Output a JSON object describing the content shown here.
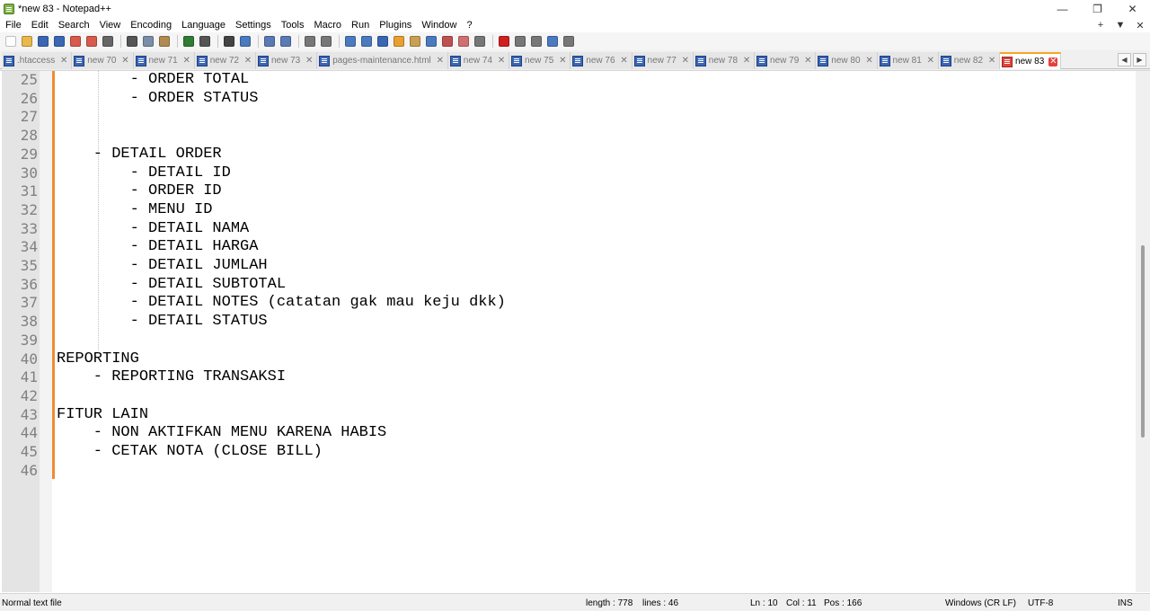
{
  "window": {
    "title": "*new 83 - Notepad++",
    "controls": [
      "—",
      "❐",
      "✕"
    ]
  },
  "menu": {
    "items": [
      "File",
      "Edit",
      "Search",
      "View",
      "Encoding",
      "Language",
      "Settings",
      "Tools",
      "Macro",
      "Run",
      "Plugins",
      "Window",
      "?"
    ],
    "right_controls": [
      "+",
      "▼",
      "✕"
    ]
  },
  "toolbar": {
    "buttons": [
      {
        "name": "new-file-icon",
        "color": "#ffffff"
      },
      {
        "name": "open-file-icon",
        "color": "#e8b84a"
      },
      {
        "name": "save-icon",
        "color": "#3a66b5"
      },
      {
        "name": "save-all-icon",
        "color": "#3a66b5"
      },
      {
        "name": "close-icon",
        "color": "#d95a4a"
      },
      {
        "name": "close-all-icon",
        "color": "#d95a4a"
      },
      {
        "name": "print-icon",
        "color": "#666666"
      },
      {
        "name": "sep"
      },
      {
        "name": "cut-icon",
        "color": "#555555"
      },
      {
        "name": "copy-icon",
        "color": "#7a8ea8"
      },
      {
        "name": "paste-icon",
        "color": "#b08a50"
      },
      {
        "name": "sep"
      },
      {
        "name": "undo-icon",
        "color": "#2e7d32"
      },
      {
        "name": "redo-icon",
        "color": "#555555"
      },
      {
        "name": "sep"
      },
      {
        "name": "find-icon",
        "color": "#444444"
      },
      {
        "name": "replace-icon",
        "color": "#4a7abf"
      },
      {
        "name": "sep"
      },
      {
        "name": "zoom-in-icon",
        "color": "#5a7ab5"
      },
      {
        "name": "zoom-out-icon",
        "color": "#5a7ab5"
      },
      {
        "name": "sep"
      },
      {
        "name": "sync-vertical-icon",
        "color": "#777777"
      },
      {
        "name": "sync-horizontal-icon",
        "color": "#777777"
      },
      {
        "name": "sep"
      },
      {
        "name": "word-wrap-icon",
        "color": "#4a7abf"
      },
      {
        "name": "show-all-chars-icon",
        "color": "#4a7abf"
      },
      {
        "name": "indent-guide-icon",
        "color": "#3a66b5"
      },
      {
        "name": "language-icon",
        "color": "#e8a030"
      },
      {
        "name": "doc-map-icon",
        "color": "#c8a050"
      },
      {
        "name": "doc-list-icon",
        "color": "#4a7abf"
      },
      {
        "name": "function-list-icon",
        "color": "#c05050"
      },
      {
        "name": "folder-workspace-icon",
        "color": "#d07070"
      },
      {
        "name": "monitoring-icon",
        "color": "#777777"
      },
      {
        "name": "sep"
      },
      {
        "name": "record-macro-icon",
        "color": "#d02020"
      },
      {
        "name": "stop-macro-icon",
        "color": "#777777"
      },
      {
        "name": "play-macro-icon",
        "color": "#777777"
      },
      {
        "name": "run-macro-multiple-icon",
        "color": "#4a7abf"
      },
      {
        "name": "save-macro-icon",
        "color": "#777777"
      }
    ]
  },
  "tabs": [
    {
      "label": ".htaccess",
      "active": false
    },
    {
      "label": "new 70",
      "active": false
    },
    {
      "label": "new 71",
      "active": false
    },
    {
      "label": "new 72",
      "active": false
    },
    {
      "label": "new 73",
      "active": false
    },
    {
      "label": "pages-maintenance.html",
      "active": false
    },
    {
      "label": "new 74",
      "active": false
    },
    {
      "label": "new 75",
      "active": false
    },
    {
      "label": "new 76",
      "active": false
    },
    {
      "label": "new 77",
      "active": false
    },
    {
      "label": "new 78",
      "active": false
    },
    {
      "label": "new 79",
      "active": false
    },
    {
      "label": "new 80",
      "active": false
    },
    {
      "label": "new 81",
      "active": false
    },
    {
      "label": "new 82",
      "active": false
    },
    {
      "label": "new 83",
      "active": true
    }
  ],
  "tab_scroll": [
    "◀",
    "▶"
  ],
  "editor": {
    "lines": [
      {
        "num": "25",
        "text": "        - ORDER TOTAL"
      },
      {
        "num": "26",
        "text": "        - ORDER STATUS"
      },
      {
        "num": "27",
        "text": ""
      },
      {
        "num": "28",
        "text": ""
      },
      {
        "num": "29",
        "text": "    - DETAIL ORDER"
      },
      {
        "num": "30",
        "text": "        - DETAIL ID"
      },
      {
        "num": "31",
        "text": "        - ORDER ID"
      },
      {
        "num": "32",
        "text": "        - MENU ID"
      },
      {
        "num": "33",
        "text": "        - DETAIL NAMA"
      },
      {
        "num": "34",
        "text": "        - DETAIL HARGA"
      },
      {
        "num": "35",
        "text": "        - DETAIL JUMLAH"
      },
      {
        "num": "36",
        "text": "        - DETAIL SUBTOTAL"
      },
      {
        "num": "37",
        "text": "        - DETAIL NOTES (catatan gak mau keju dkk)"
      },
      {
        "num": "38",
        "text": "        - DETAIL STATUS"
      },
      {
        "num": "39",
        "text": ""
      },
      {
        "num": "40",
        "text": "REPORTING"
      },
      {
        "num": "41",
        "text": "    - REPORTING TRANSAKSI"
      },
      {
        "num": "42",
        "text": ""
      },
      {
        "num": "43",
        "text": "FITUR LAIN"
      },
      {
        "num": "44",
        "text": "    - NON AKTIFKAN MENU KARENA HABIS"
      },
      {
        "num": "45",
        "text": "    - CETAK NOTA (CLOSE BILL)"
      },
      {
        "num": "46",
        "text": ""
      }
    ]
  },
  "status": {
    "file_type": "Normal text file",
    "length": "length : 778",
    "lines": "lines : 46",
    "ln": "Ln : 10",
    "col": "Col : 11",
    "pos": "Pos : 166",
    "eol": "Windows (CR LF)",
    "encoding": "UTF-8",
    "mode": "INS"
  }
}
